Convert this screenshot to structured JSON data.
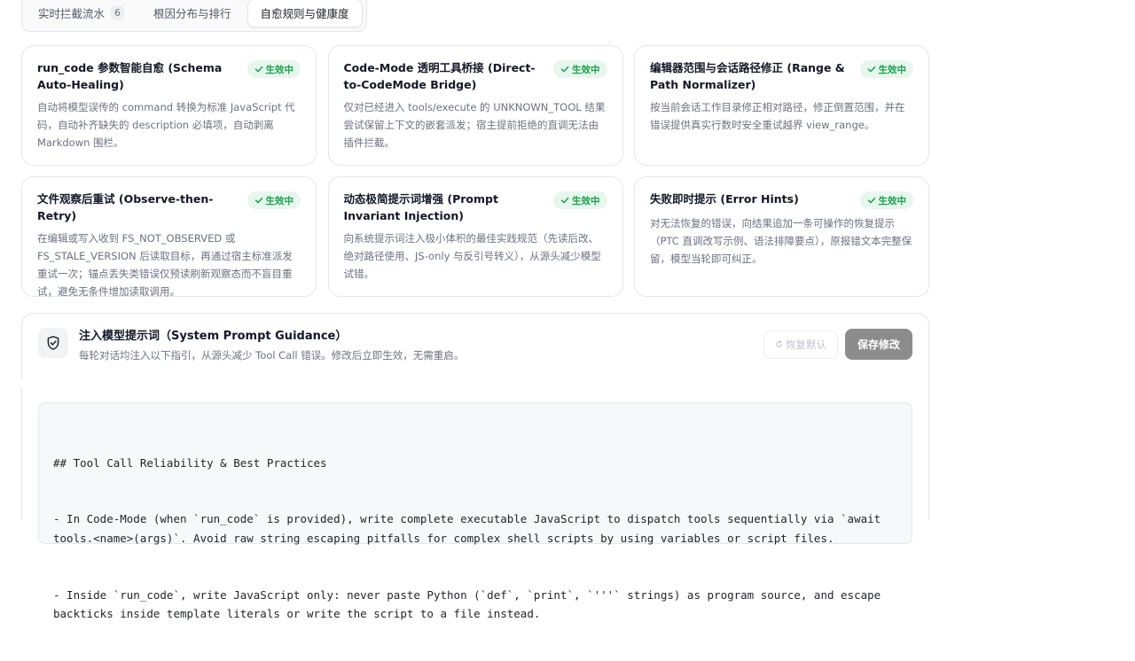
{
  "tabs": [
    {
      "label": "实时拦截流水",
      "badge": "6",
      "active": false
    },
    {
      "label": "根因分布与排行",
      "active": false
    },
    {
      "label": "自愈规则与健康度",
      "active": true
    }
  ],
  "status_label": "生效中",
  "colors": {
    "status_green": "#16a34a",
    "status_bg": "#e8f7ee",
    "save_button": "#8c8c8c"
  },
  "cards": [
    {
      "title": "run_code 参数智能自愈 (Schema Auto-Healing)",
      "desc": "自动将模型误传的 command 转换为标准 JavaScript 代码，自动补齐缺失的 description 必填项，自动剥离 Markdown 围栏。"
    },
    {
      "title": "Code-Mode 透明工具桥接 (Direct-to-CodeMode Bridge)",
      "desc": "仅对已经进入 tools/execute 的 UNKNOWN_TOOL 结果尝试保留上下文的嵌套派发；宿主提前拒绝的直调无法由插件拦截。"
    },
    {
      "title": "编辑器范围与会话路径修正 (Range & Path Normalizer)",
      "desc": "按当前会话工作目录修正相对路径，修正倒置范围，并在错误提供真实行数时安全重试越界 view_range。"
    },
    {
      "title": "文件观察后重试 (Observe-then-Retry)",
      "desc": "在编辑或写入收到 FS_NOT_OBSERVED 或 FS_STALE_VERSION 后读取目标，再通过宿主标准派发重试一次；锚点丢失类错误仅预读刷新观察态而不盲目重试，避免无条件增加读取调用。"
    },
    {
      "title": "动态极简提示词增强 (Prompt Invariant Injection)",
      "desc": "向系统提示词注入极小体积的最佳实践规范（先读后改、绝对路径使用、JS-only 与反引号转义），从源头减少模型试错。"
    },
    {
      "title": "失败即时提示 (Error Hints)",
      "desc": "对无法恢复的错误，向结果追加一条可操作的恢复提示（PTC 直调改写示例、语法排障要点），原报错文本完整保留，模型当轮即可纠正。"
    }
  ],
  "guidance": {
    "icon": "shield-check-icon",
    "title": "注入模型提示词（System Prompt Guidance）",
    "subtitle": "每轮对话均注入以下指引，从源头减少 Tool Call 错误。修改后立即生效，无需重启。",
    "reset_label": "恢复默认",
    "save_label": "保存修改"
  },
  "code_lines": [
    "## Tool Call Reliability & Best Practices",
    "- In Code-Mode (when `run_code` is provided), write complete executable JavaScript to dispatch tools sequentially via `await tools.<name>(args)`. Avoid raw string escaping pitfalls for complex shell scripts by using variables or script files.",
    "- Inside `run_code`, write JavaScript only: never paste Python (`def`, `print`, `'''` strings) as program source, and escape backticks inside template literals or write the script to a file instead."
  ]
}
